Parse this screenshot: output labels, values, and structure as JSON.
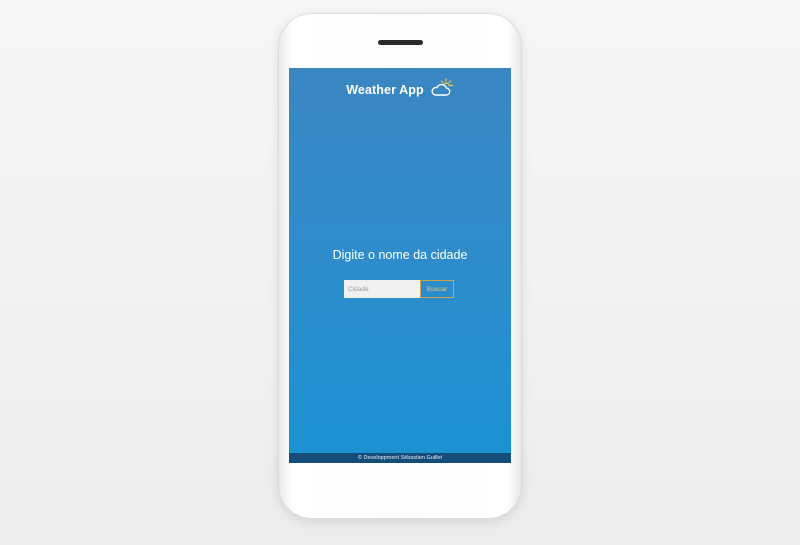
{
  "app": {
    "title": "Weather App",
    "icon": "cloud-sun-icon",
    "accent_color": "#e8c774"
  },
  "main": {
    "prompt": "Digite o nome da cidade"
  },
  "search": {
    "placeholder": "Cidade",
    "value": "",
    "button_label": "Buscar"
  },
  "footer": {
    "text": "© Developpment Sébastien Guillet"
  }
}
